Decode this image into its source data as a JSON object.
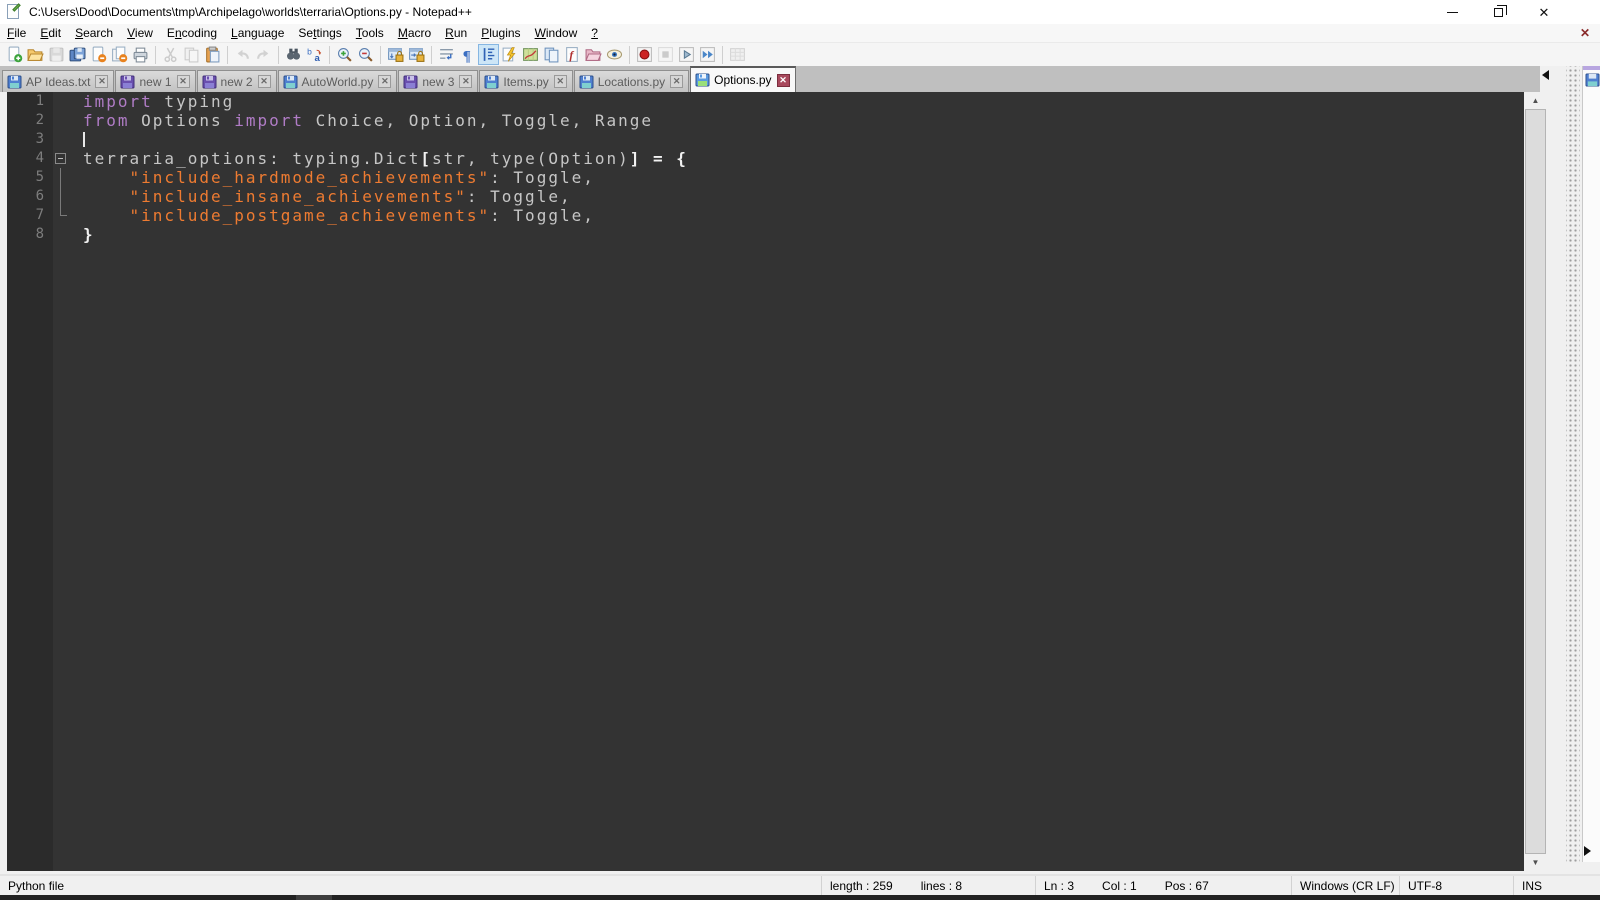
{
  "window": {
    "title": "C:\\Users\\Dood\\Documents\\tmp\\Archipelago\\worlds\\terraria\\Options.py - Notepad++",
    "controls": {
      "minimize": "minimize",
      "restore": "restore",
      "close": "close"
    }
  },
  "menu": {
    "items": [
      {
        "label": "File",
        "u": 0
      },
      {
        "label": "Edit",
        "u": 0
      },
      {
        "label": "Search",
        "u": 0
      },
      {
        "label": "View",
        "u": 0
      },
      {
        "label": "Encoding",
        "u": 1
      },
      {
        "label": "Language",
        "u": 0
      },
      {
        "label": "Settings",
        "u": 2
      },
      {
        "label": "Tools",
        "u": 0
      },
      {
        "label": "Macro",
        "u": 0
      },
      {
        "label": "Run",
        "u": 0
      },
      {
        "label": "Plugins",
        "u": 0
      },
      {
        "label": "Window",
        "u": 0
      },
      {
        "label": "?",
        "u": 0
      }
    ]
  },
  "toolbar": {
    "items": [
      {
        "name": "new-file"
      },
      {
        "name": "open-file"
      },
      {
        "name": "save-file",
        "state": "disabled"
      },
      {
        "name": "save-all"
      },
      {
        "name": "close-file"
      },
      {
        "name": "close-all"
      },
      {
        "name": "print"
      },
      {
        "name": "separator"
      },
      {
        "name": "cut",
        "state": "disabled"
      },
      {
        "name": "copy",
        "state": "disabled"
      },
      {
        "name": "paste"
      },
      {
        "name": "separator"
      },
      {
        "name": "undo",
        "state": "disabled"
      },
      {
        "name": "redo",
        "state": "disabled"
      },
      {
        "name": "separator"
      },
      {
        "name": "find"
      },
      {
        "name": "replace"
      },
      {
        "name": "separator"
      },
      {
        "name": "zoom-in"
      },
      {
        "name": "zoom-out"
      },
      {
        "name": "separator"
      },
      {
        "name": "sync-vertical"
      },
      {
        "name": "sync-horizontal"
      },
      {
        "name": "separator"
      },
      {
        "name": "word-wrap"
      },
      {
        "name": "show-all-characters"
      },
      {
        "name": "indent-guide",
        "state": "active"
      },
      {
        "name": "function-completion"
      },
      {
        "name": "document-map"
      },
      {
        "name": "document-list"
      },
      {
        "name": "function-list"
      },
      {
        "name": "folder-as-workspace"
      },
      {
        "name": "monitoring"
      },
      {
        "name": "separator"
      },
      {
        "name": "macro-record"
      },
      {
        "name": "macro-stop",
        "state": "disabled"
      },
      {
        "name": "macro-play"
      },
      {
        "name": "macro-run-multiple"
      },
      {
        "name": "separator"
      },
      {
        "name": "macro-save",
        "state": "disabled"
      }
    ]
  },
  "tabs": {
    "items": [
      {
        "label": "AP Ideas.txt",
        "icon": "floppy-blue",
        "active": false
      },
      {
        "label": "new 1",
        "icon": "floppy-purple",
        "active": false
      },
      {
        "label": "new 2",
        "icon": "floppy-purple",
        "active": false
      },
      {
        "label": "AutoWorld.py",
        "icon": "floppy-blue",
        "active": false
      },
      {
        "label": "new 3",
        "icon": "floppy-purple",
        "active": false
      },
      {
        "label": "Items.py",
        "icon": "floppy-blue",
        "active": false
      },
      {
        "label": "Locations.py",
        "icon": "floppy-blue",
        "active": false
      },
      {
        "label": "Options.py",
        "icon": "floppy-active",
        "active": true
      }
    ],
    "close_glyph": "x"
  },
  "editor": {
    "colors": {
      "background": "#333333",
      "gutter": "#2b2b2b",
      "line_number": "#7d7d7d",
      "keyword": "#b07cc6",
      "default": "#c6c6c6",
      "operator": "#f2f2f2",
      "string": "#ee7b31",
      "caret": "#e8e8e8"
    },
    "lines": [
      {
        "num": "1",
        "fold": "none",
        "segments": [
          {
            "text": "import",
            "style": "keyword"
          },
          {
            "text": " typing",
            "style": "default"
          }
        ]
      },
      {
        "num": "2",
        "fold": "none",
        "segments": [
          {
            "text": "from",
            "style": "keyword"
          },
          {
            "text": " Options ",
            "style": "default"
          },
          {
            "text": "import",
            "style": "keyword"
          },
          {
            "text": " Choice, Option, Toggle, Range",
            "style": "default"
          }
        ]
      },
      {
        "num": "3",
        "fold": "none",
        "caret": true,
        "segments": []
      },
      {
        "num": "4",
        "fold": "open",
        "segments": [
          {
            "text": "terraria_options: typing.Dict",
            "style": "default"
          },
          {
            "text": "[",
            "style": "operator"
          },
          {
            "text": "str, type(Option)",
            "style": "default"
          },
          {
            "text": "]",
            "style": "operator"
          },
          {
            "text": " = {",
            "style": "operator"
          }
        ]
      },
      {
        "num": "5",
        "fold": "line",
        "segments": [
          {
            "text": "    ",
            "style": "default"
          },
          {
            "text": "\"include_hardmode_achievements\"",
            "style": "string"
          },
          {
            "text": ": Toggle,",
            "style": "default"
          }
        ]
      },
      {
        "num": "6",
        "fold": "line",
        "segments": [
          {
            "text": "    ",
            "style": "default"
          },
          {
            "text": "\"include_insane_achievements\"",
            "style": "string"
          },
          {
            "text": ": Toggle,",
            "style": "default"
          }
        ]
      },
      {
        "num": "7",
        "fold": "end",
        "segments": [
          {
            "text": "    ",
            "style": "default"
          },
          {
            "text": "\"include_postgame_achievements\"",
            "style": "string"
          },
          {
            "text": ": Toggle,",
            "style": "default"
          }
        ]
      },
      {
        "num": "8",
        "fold": "none",
        "segments": [
          {
            "text": "}",
            "style": "operator"
          }
        ]
      }
    ]
  },
  "statusbar": {
    "doc_type": "Python file",
    "length_label": "length : 259",
    "lines_label": "lines : 8",
    "ln_label": "Ln : 3",
    "col_label": "Col : 1",
    "pos_label": "Pos : 67",
    "eol": "Windows (CR LF)",
    "encoding": "UTF-8",
    "insert_mode": "INS"
  }
}
